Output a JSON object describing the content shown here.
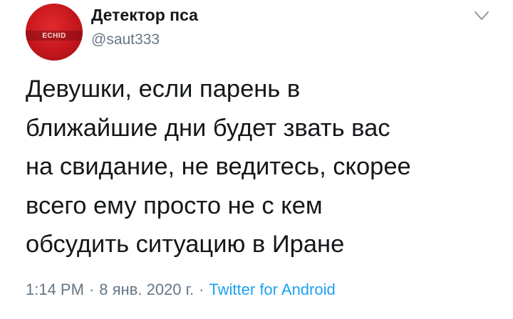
{
  "user": {
    "display_name": "Детектор пса",
    "handle": "@saut333",
    "avatar_text": "ECHID"
  },
  "tweet": {
    "lines": [
      "Девушки, если парень в",
      "ближайшие дни будет звать вас",
      "на свидание, не ведитесь, скорее",
      "всего ему просто не с кем",
      "обсудить ситуацию в Иране"
    ]
  },
  "meta": {
    "time": "1:14 PM",
    "separator": "·",
    "date": "8 янв. 2020 г.",
    "source": "Twitter for Android"
  },
  "icons": {
    "menu": "chevron-down-icon"
  },
  "colors": {
    "text": "#14171a",
    "secondary": "#657786",
    "link": "#1da1f2",
    "avatar": "#c4161c"
  }
}
